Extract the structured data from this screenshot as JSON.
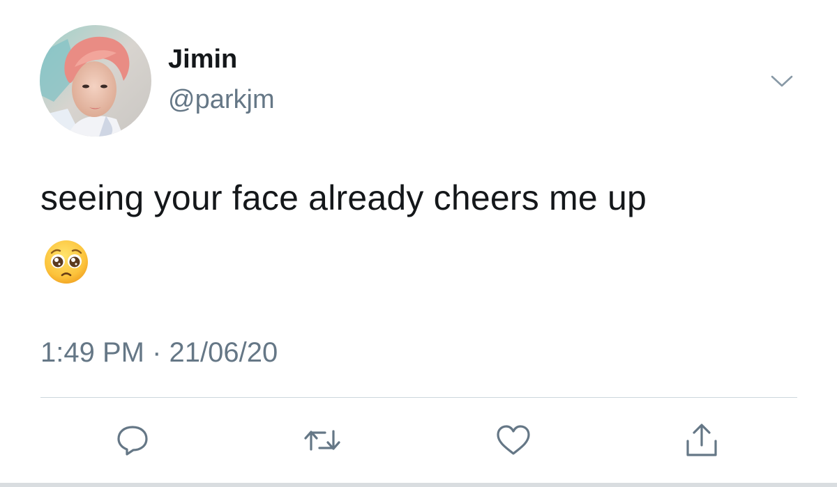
{
  "user": {
    "display_name": "Jimin",
    "handle": "@parkjm",
    "avatar": "avatar-photo"
  },
  "tweet": {
    "text": "seeing your face already cheers me up",
    "emoji": "pleading-face-emoji",
    "time": "1:49 PM",
    "separator": "·",
    "date": "21/06/20",
    "meta_line": "1:49 PM · 21/06/20"
  },
  "icons": {
    "menu": "chevron-down-icon",
    "reply": "reply-icon",
    "retweet": "retweet-icon",
    "like": "heart-icon",
    "share": "share-icon"
  },
  "colors": {
    "text": "#14171a",
    "secondary": "#657786",
    "icon": "#657786",
    "divider": "#ccd6dd",
    "background": "#ffffff"
  }
}
